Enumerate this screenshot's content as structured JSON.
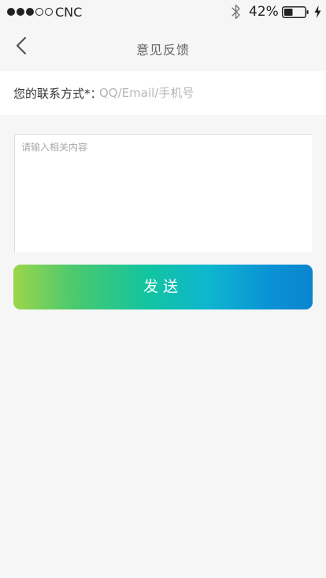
{
  "status_bar": {
    "carrier": "CNC",
    "signal_strength": 3,
    "signal_max": 5,
    "battery_percent": "42%",
    "battery_level": 0.42,
    "bluetooth_icon": "bluetooth-icon",
    "charging_icon": "charging-bolt-icon"
  },
  "nav": {
    "title": "意见反馈",
    "back_icon": "chevron-left-icon"
  },
  "form": {
    "contact_label": "您的联系方式*：",
    "contact_placeholder": "QQ/Email/手机号",
    "contact_value": "",
    "content_placeholder": "请输入相关内容",
    "content_value": "",
    "send_label": "发送"
  },
  "colors": {
    "background": "#f6f6f6",
    "gradient_start": "#9bd64a",
    "gradient_mid": "#12c4a0",
    "gradient_end": "#0a85cf"
  }
}
